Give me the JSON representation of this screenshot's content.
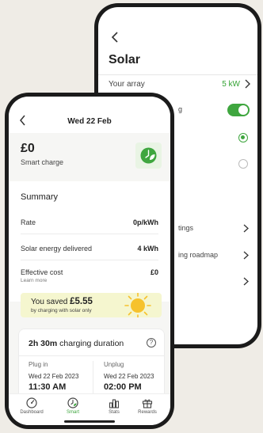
{
  "back_screen": {
    "title": "Solar",
    "array_label": "Your array",
    "array_value": "5 kW",
    "row_g_fragment": "g",
    "rows": [
      {
        "label": "tings"
      },
      {
        "label": "ing roadmap"
      }
    ]
  },
  "front_screen": {
    "header_title": "Wed 22 Feb",
    "amount": "£0",
    "amount_label": "Smart charge",
    "summary": {
      "title": "Summary",
      "rate_label": "Rate",
      "rate_value": "0p/kWh",
      "solar_label": "Solar energy delivered",
      "solar_value": "4 kWh",
      "cost_label": "Effective cost",
      "cost_value": "£0",
      "cost_link": "Learn more"
    },
    "saved": {
      "prefix": "You saved",
      "amount": "£5.55",
      "subtitle": "by charging with solar only"
    },
    "duration": {
      "value": "2h 30m",
      "suffix": "charging duration",
      "help": "?",
      "plug_in_label": "Plug in",
      "plug_in_date": "Wed 22 Feb 2023",
      "plug_in_time": "11:30 AM",
      "unplug_label": "Unplug",
      "unplug_date": "Wed 22 Feb 2023",
      "unplug_time": "02:00 PM"
    },
    "tabs": [
      {
        "label": "Dashboard",
        "active": false
      },
      {
        "label": "Smart",
        "active": true
      },
      {
        "label": "Stats",
        "active": false
      },
      {
        "label": "Rewards",
        "active": false
      }
    ]
  },
  "colors": {
    "accent_green": "#3fa63f",
    "saved_banner": "#f5f6cf",
    "sun": "#f6c22d"
  }
}
